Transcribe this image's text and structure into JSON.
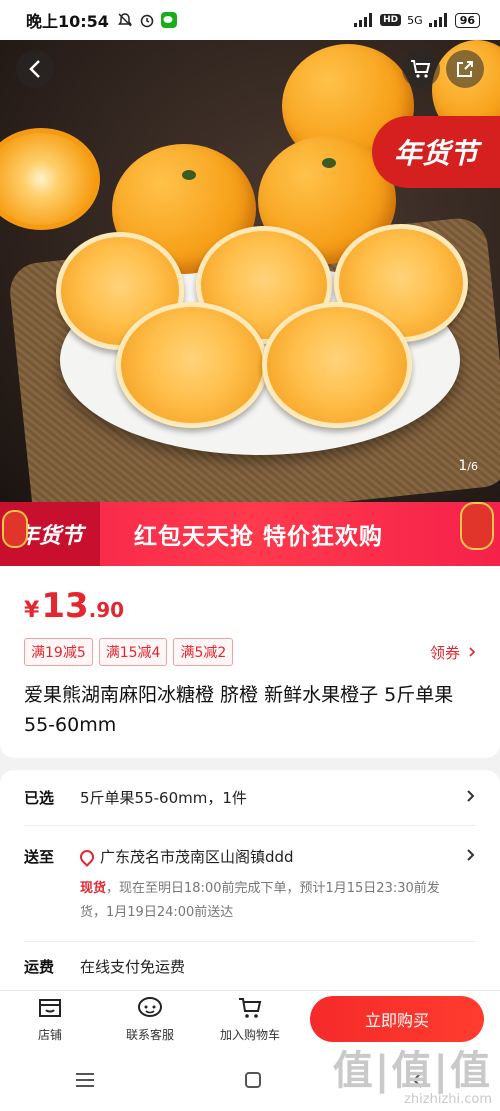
{
  "status_bar": {
    "time": "晚上10:54",
    "network": "5G",
    "battery": "96"
  },
  "hero": {
    "image_counter_current": "1",
    "image_counter_total": "/6",
    "promo_tag": "年货节"
  },
  "banner": {
    "logo_text": "年货节",
    "slogan": "红包天天抢 特价狂欢购"
  },
  "price": {
    "currency": "¥",
    "integer": "13",
    "decimal": ".90",
    "color": "#e4262f"
  },
  "coupons": [
    "满19减5",
    "满15减4",
    "满5减2"
  ],
  "get_coupon_label": "领券",
  "product_title": "爱果熊湖南麻阳冰糖橙 脐橙 新鲜水果橙子 5斤单果55-60mm",
  "selection": {
    "label": "已选",
    "value": "5斤单果55-60mm，1件"
  },
  "delivery": {
    "label": "送至",
    "address": "广东茂名市茂南区山阁镇ddd",
    "stock": "现货",
    "note": "，现在至明日18:00前完成下单，预计1月15日23:30前发货，1月19日24:00前送达"
  },
  "shipping": {
    "label": "运费",
    "value": "在线支付免运费"
  },
  "bottom_bar": {
    "store": "店铺",
    "service": "联系客服",
    "cart": "加入购物车",
    "buy": "立即购买"
  },
  "watermark": {
    "big": "值|值|值",
    "small": "zhizhizhi.com"
  }
}
